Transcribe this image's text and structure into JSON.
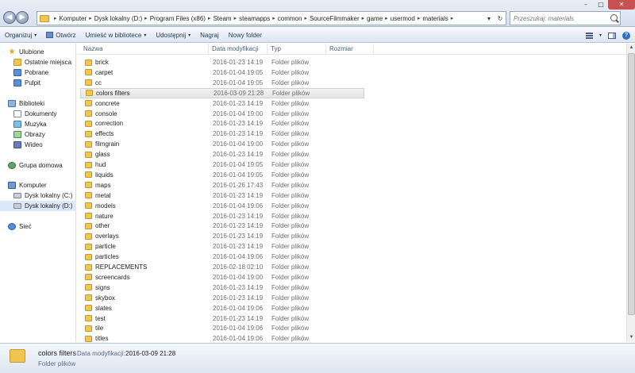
{
  "window": {
    "minimize_glyph": "–",
    "maximize_glyph": "□",
    "close_glyph": "✕"
  },
  "nav": {
    "back_glyph": "◀",
    "forward_glyph": "▶",
    "recent_glyph": "▾"
  },
  "address": {
    "crumbs": [
      "Komputer",
      "Dysk lokalny (D:)",
      "Program Files (x86)",
      "Steam",
      "steamapps",
      "common",
      "SourceFilmmaker",
      "game",
      "usermod",
      "materials"
    ],
    "dropdown_glyph": "▾",
    "refresh_glyph": "↻"
  },
  "search": {
    "placeholder": "Przeszukaj: materials"
  },
  "toolbar": {
    "organize": "Organizuj",
    "open": "Otwórz",
    "add_to_library": "Umieść w bibliotece",
    "share": "Udostępnij",
    "burn": "Nagraj",
    "new_folder": "Nowy folder",
    "caret": "▾",
    "help": "?"
  },
  "sidebar": {
    "favorites": {
      "label": "Ulubione",
      "items": [
        "Ostatnie miejsca",
        "Pobrane",
        "Pulpit"
      ]
    },
    "libraries": {
      "label": "Biblioteki",
      "items": [
        "Dokumenty",
        "Muzyka",
        "Obrazy",
        "Wideo"
      ]
    },
    "homegroup": "Grupa domowa",
    "computer": {
      "label": "Komputer",
      "items": [
        "Dysk lokalny (C:)",
        "Dysk lokalny (D:)"
      ]
    },
    "network": "Sieć"
  },
  "columns": {
    "name": "Nazwa",
    "date": "Data modyfikacji",
    "type": "Typ",
    "size": "Rozmiar"
  },
  "files": [
    {
      "name": "brick",
      "date": "2016-01-23 14:19",
      "type": "Folder plików"
    },
    {
      "name": "carpet",
      "date": "2016-01-04 19:05",
      "type": "Folder plików"
    },
    {
      "name": "cc",
      "date": "2016-01-04 19:05",
      "type": "Folder plików"
    },
    {
      "name": "colors filters",
      "date": "2016-03-09 21:28",
      "type": "Folder plików"
    },
    {
      "name": "concrete",
      "date": "2016-01-23 14:19",
      "type": "Folder plików"
    },
    {
      "name": "console",
      "date": "2016-01-04 19:00",
      "type": "Folder plików"
    },
    {
      "name": "correction",
      "date": "2016-01-23 14:19",
      "type": "Folder plików"
    },
    {
      "name": "effects",
      "date": "2016-01-23 14:19",
      "type": "Folder plików"
    },
    {
      "name": "filmgrain",
      "date": "2016-01-04 19:00",
      "type": "Folder plików"
    },
    {
      "name": "glass",
      "date": "2016-01-23 14:19",
      "type": "Folder plików"
    },
    {
      "name": "hud",
      "date": "2016-01-04 19:05",
      "type": "Folder plików"
    },
    {
      "name": "liquids",
      "date": "2016-01-04 19:05",
      "type": "Folder plików"
    },
    {
      "name": "maps",
      "date": "2016-01-26 17:43",
      "type": "Folder plików"
    },
    {
      "name": "metal",
      "date": "2016-01-23 14:19",
      "type": "Folder plików"
    },
    {
      "name": "models",
      "date": "2016-01-04 19:06",
      "type": "Folder plików"
    },
    {
      "name": "nature",
      "date": "2016-01-23 14:19",
      "type": "Folder plików"
    },
    {
      "name": "other",
      "date": "2016-01-23 14:19",
      "type": "Folder plików"
    },
    {
      "name": "overlays",
      "date": "2016-01-23 14:19",
      "type": "Folder plików"
    },
    {
      "name": "particle",
      "date": "2016-01-23 14:19",
      "type": "Folder plików"
    },
    {
      "name": "particles",
      "date": "2016-01-04 19:06",
      "type": "Folder plików"
    },
    {
      "name": "REPLACEMENTS",
      "date": "2016-02-18 02:10",
      "type": "Folder plików"
    },
    {
      "name": "screencards",
      "date": "2016-01-04 19:00",
      "type": "Folder plików"
    },
    {
      "name": "signs",
      "date": "2016-01-23 14:19",
      "type": "Folder plików"
    },
    {
      "name": "skybox",
      "date": "2016-01-23 14:19",
      "type": "Folder plików"
    },
    {
      "name": "slates",
      "date": "2016-01-04 19:06",
      "type": "Folder plików"
    },
    {
      "name": "test",
      "date": "2016-01-23 14:19",
      "type": "Folder plików"
    },
    {
      "name": "tile",
      "date": "2016-01-04 19:06",
      "type": "Folder plików"
    },
    {
      "name": "titles",
      "date": "2016-01-04 19:06",
      "type": "Folder plików"
    }
  ],
  "selected_index": 3,
  "details": {
    "name": "colors filters",
    "date_label": "Data modyfikacji:",
    "date": "2016-03-09 21:28",
    "type": "Folder plików"
  },
  "scrollbar": {
    "up_glyph": "▲",
    "down_glyph": "▼"
  }
}
